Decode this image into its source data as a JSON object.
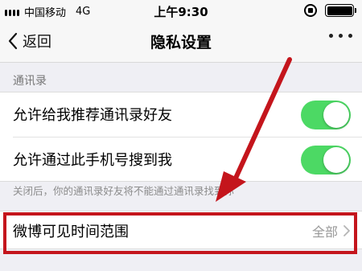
{
  "status_bar": {
    "carrier": "中国移动",
    "network": "4G",
    "time": "上午9:30"
  },
  "nav": {
    "back_label": "返回",
    "title": "隐私设置"
  },
  "section": {
    "title": "通讯录",
    "items": [
      {
        "label": "允许给我推荐通讯录好友",
        "enabled": true
      },
      {
        "label": "允许通过此手机号搜到我",
        "enabled": true
      }
    ],
    "hint": "关闭后，你的通讯录好友将不能通过通讯录找到你"
  },
  "weibo": {
    "label": "微博可见时间范围",
    "value": "全部"
  },
  "colors": {
    "toggle_on": "#4cd964",
    "annotation": "#c4151c"
  }
}
